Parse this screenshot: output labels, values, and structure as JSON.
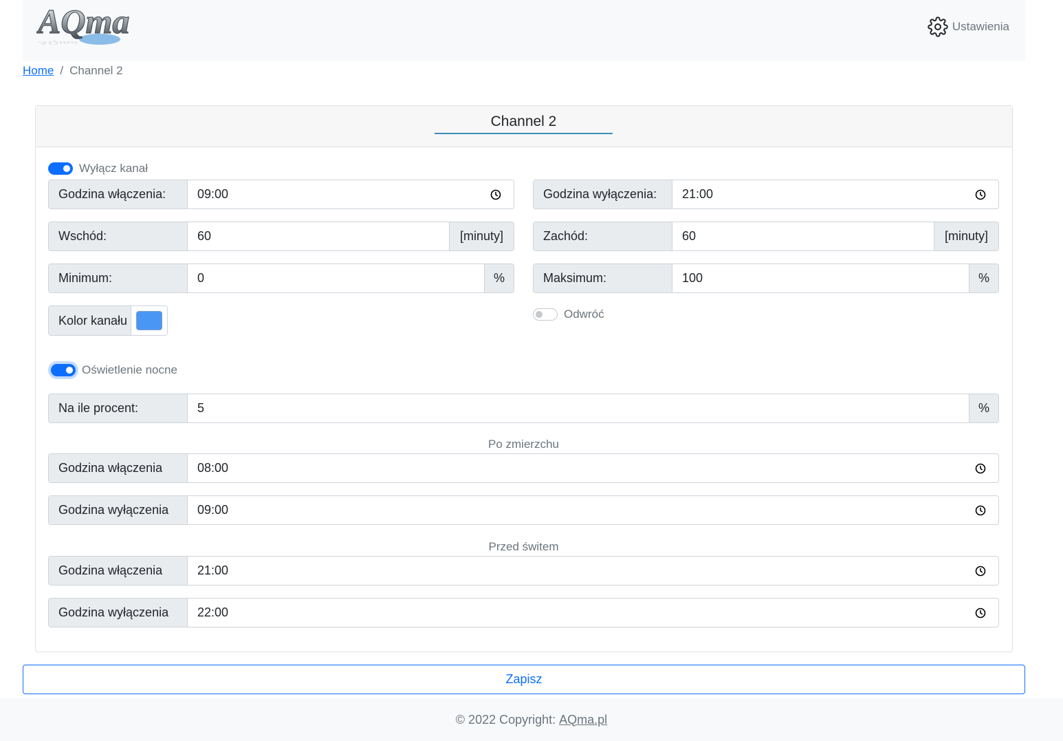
{
  "navbar": {
    "logo_text": "AQma",
    "settings_label": "Ustawienia"
  },
  "breadcrumb": {
    "home": "Home",
    "separator": "/",
    "current": "Channel 2"
  },
  "card": {
    "title": "Channel 2",
    "disable_channel": {
      "label": "Wyłącz kanał",
      "checked": true
    },
    "on_time": {
      "label": "Godzina włączenia:",
      "value": "09:00"
    },
    "off_time": {
      "label": "Godzina wyłączenia:",
      "value": "21:00"
    },
    "sunrise": {
      "label": "Wschód:",
      "value": "60",
      "unit": "[minuty]"
    },
    "sunset": {
      "label": "Zachód:",
      "value": "60",
      "unit": "[minuty]"
    },
    "minimum": {
      "label": "Minimum:",
      "value": "0",
      "unit": "%"
    },
    "maximum": {
      "label": "Maksimum:",
      "value": "100",
      "unit": "%"
    },
    "channel_color": {
      "label": "Kolor kanału",
      "color": "#4a96f5"
    },
    "invert": {
      "label": "Odwróć",
      "checked": false
    },
    "night_light": {
      "label": "Oświetlenie nocne",
      "checked": true
    },
    "night_percent": {
      "label": "Na ile procent:",
      "value": "5",
      "unit": "%"
    },
    "after_dusk": {
      "caption": "Po zmierzchu",
      "on": {
        "label": "Godzina włączenia",
        "value": "08:00"
      },
      "off": {
        "label": "Godzina wyłączenia",
        "value": "09:00"
      }
    },
    "before_dawn": {
      "caption": "Przed świtem",
      "on": {
        "label": "Godzina włączenia",
        "value": "21:00"
      },
      "off": {
        "label": "Godzina wyłączenia",
        "value": "22:00"
      }
    }
  },
  "save_button": "Zapisz",
  "footer": {
    "copyright": "© 2022 Copyright:",
    "link": "AQma.pl"
  },
  "colors": {
    "primary": "#0d6efd",
    "addon_bg": "#e9ecef",
    "title_underline": "#3a8fb7"
  }
}
